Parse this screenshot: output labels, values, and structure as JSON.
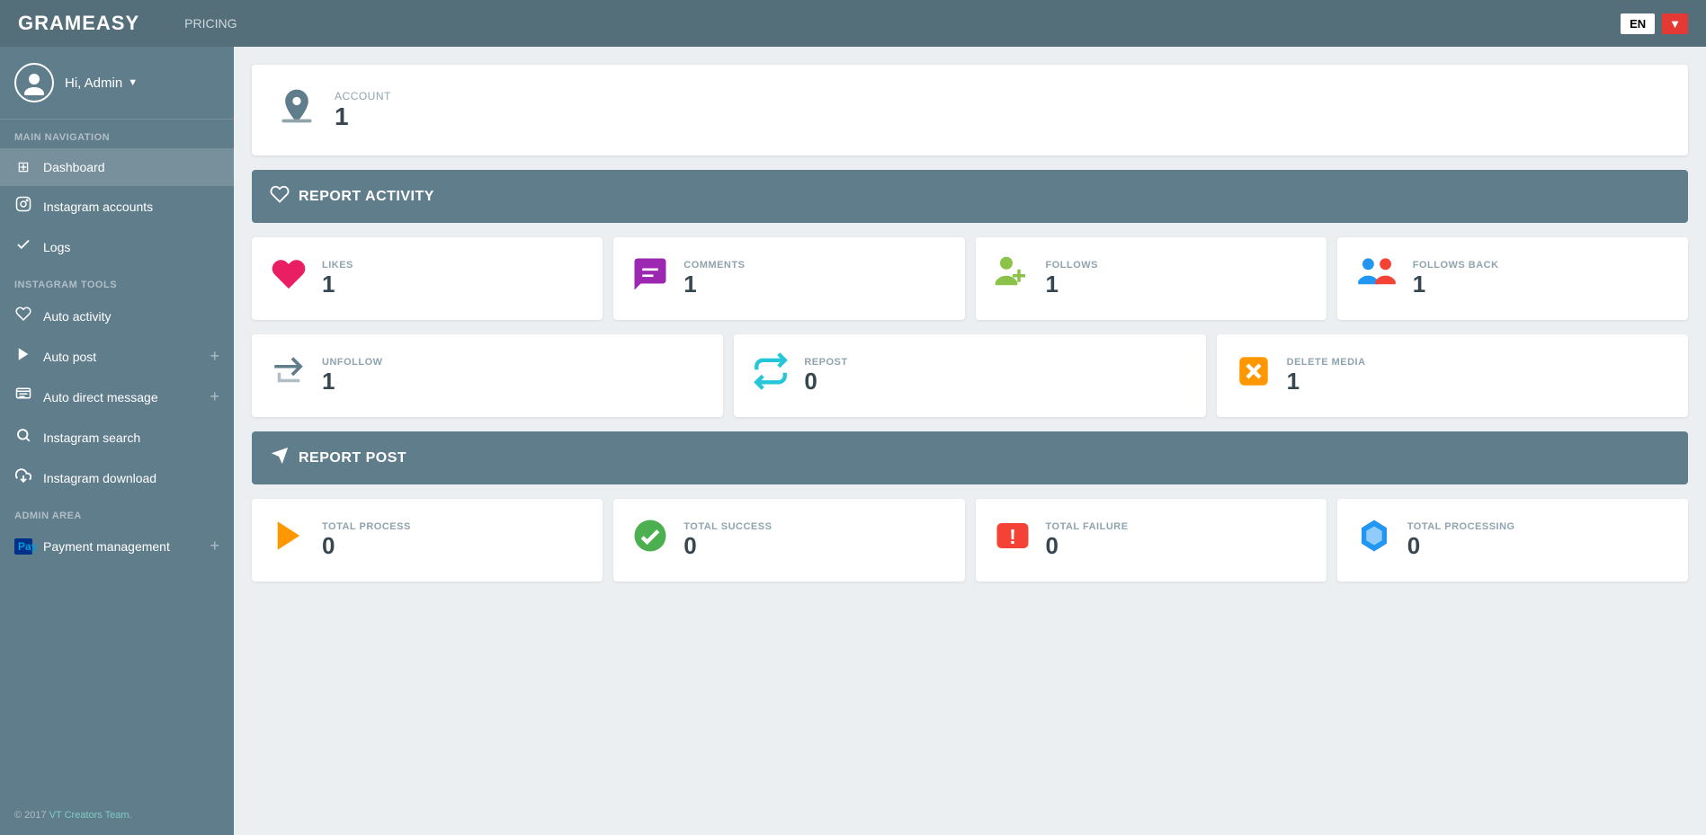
{
  "topNav": {
    "logo": "GRAMEASY",
    "pricing": "PRICING",
    "lang": "EN"
  },
  "sidebar": {
    "user": {
      "greeting": "Hi, Admin",
      "caret": "▼"
    },
    "mainNav": {
      "label": "MAIN NAVIGATION",
      "items": [
        {
          "id": "dashboard",
          "icon": "⊞",
          "label": "Dashboard"
        },
        {
          "id": "instagram-accounts",
          "icon": "◯",
          "label": "Instagram accounts"
        },
        {
          "id": "logs",
          "icon": "✓",
          "label": "Logs"
        }
      ]
    },
    "instagramTools": {
      "label": "INSTAGRAM TOOLS",
      "items": [
        {
          "id": "auto-activity",
          "icon": "♡",
          "label": "Auto activity"
        },
        {
          "id": "auto-post",
          "icon": "▷",
          "label": "Auto post",
          "plus": true
        },
        {
          "id": "auto-direct-message",
          "icon": "▤",
          "label": "Auto direct message",
          "plus": true
        },
        {
          "id": "instagram-search",
          "icon": "🔍",
          "label": "Instagram search"
        },
        {
          "id": "instagram-download",
          "icon": "⬇",
          "label": "Instagram download"
        }
      ]
    },
    "adminArea": {
      "label": "ADMIN AREA",
      "items": [
        {
          "id": "payment-management",
          "icon": "P",
          "label": "Payment management",
          "plus": true
        }
      ]
    },
    "footer": "© 2017 ",
    "footerLink": "VT Creators Team",
    "footerEnd": "."
  },
  "accountCard": {
    "label": "ACCOUNT",
    "value": "1"
  },
  "reportActivity": {
    "title": "REPORT ACTIVITY",
    "stats": [
      {
        "id": "likes",
        "label": "LIKES",
        "value": "1",
        "color": "#e91e63"
      },
      {
        "id": "comments",
        "label": "COMMENTS",
        "value": "1",
        "color": "#9c27b0"
      },
      {
        "id": "follows",
        "label": "FOLLOWS",
        "value": "1",
        "color": "#8bc34a"
      },
      {
        "id": "follows-back",
        "label": "FOLLOWS BACK",
        "value": "1",
        "color": "#2196f3"
      },
      {
        "id": "unfollow",
        "label": "UNFOLLOW",
        "value": "1",
        "color": "#607d8b"
      },
      {
        "id": "repost",
        "label": "REPOST",
        "value": "0",
        "color": "#26c6da"
      },
      {
        "id": "delete-media",
        "label": "DELETE MEDIA",
        "value": "1",
        "color": "#ff9800"
      }
    ]
  },
  "reportPost": {
    "title": "REPORT POST",
    "stats": [
      {
        "id": "total-process",
        "label": "TOTAL PROCESS",
        "value": "0",
        "color": "#ff9800"
      },
      {
        "id": "total-success",
        "label": "TOTAL SUCCESS",
        "value": "0",
        "color": "#4caf50"
      },
      {
        "id": "total-failure",
        "label": "TOTAL FAILURE",
        "value": "0",
        "color": "#f44336"
      },
      {
        "id": "total-processing",
        "label": "TOTAL PROCESSING",
        "value": "0",
        "color": "#2196f3"
      }
    ]
  }
}
